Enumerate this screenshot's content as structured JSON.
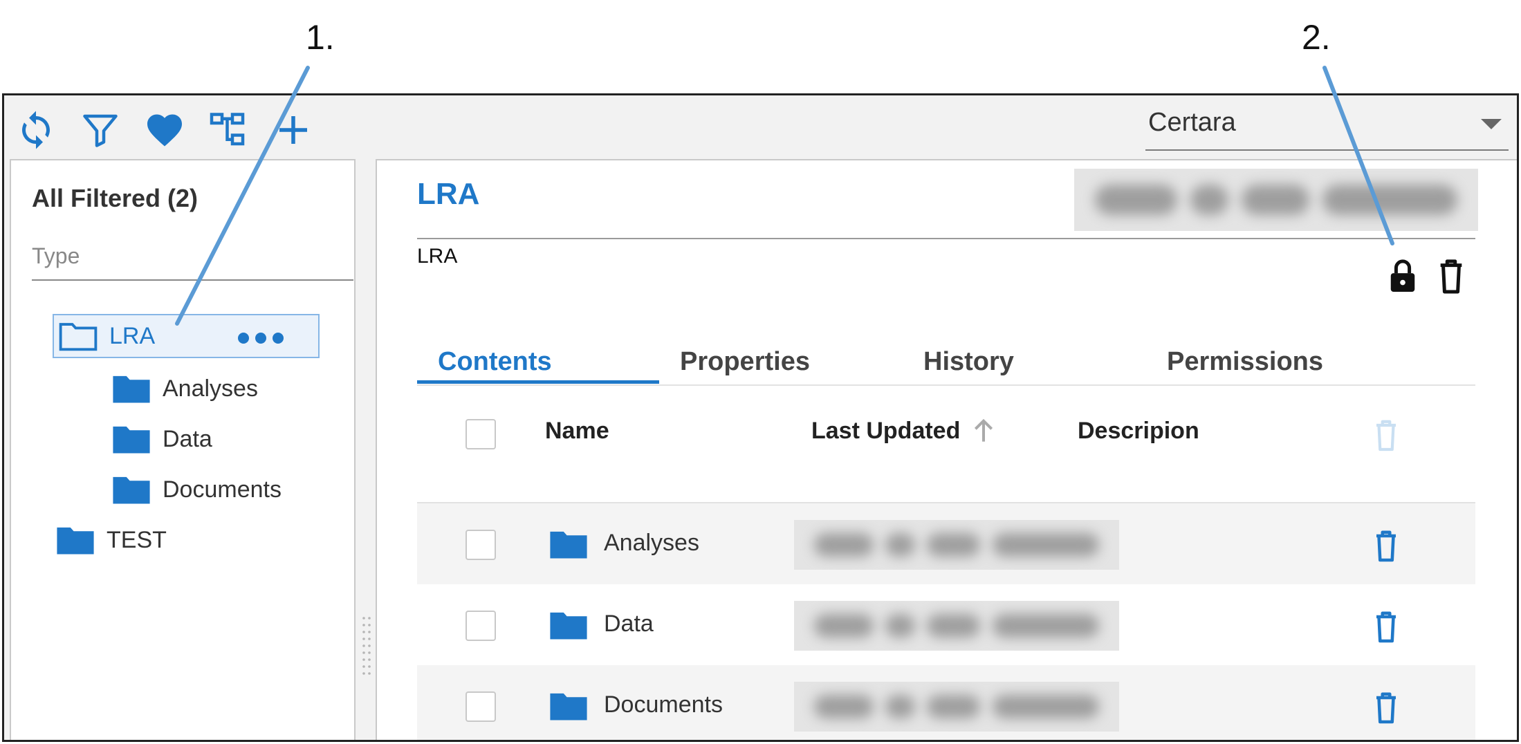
{
  "annotations": {
    "one": "1.",
    "two": "2."
  },
  "toolbar": {
    "icons": [
      "refresh-icon",
      "filter-icon",
      "heart-icon",
      "hierarchy-icon",
      "add-icon"
    ],
    "organization": "Certara"
  },
  "colors": {
    "accent": "#1f78c8",
    "annotation_line": "#5b9bd5"
  },
  "left_panel": {
    "title": "All Filtered (2)",
    "type_label": "Type",
    "tree": [
      {
        "label": "LRA",
        "selected": true
      },
      {
        "label": "Analyses"
      },
      {
        "label": "Data"
      },
      {
        "label": "Documents"
      },
      {
        "label": "TEST"
      }
    ]
  },
  "detail": {
    "title": "LRA",
    "subtitle": "LRA",
    "tabs": [
      {
        "label": "Contents",
        "active": true
      },
      {
        "label": "Properties"
      },
      {
        "label": "History"
      },
      {
        "label": "Permissions"
      }
    ],
    "columns": {
      "name": "Name",
      "last_updated": "Last Updated",
      "description": "Descripion"
    },
    "rows": [
      {
        "name": "Analyses"
      },
      {
        "name": "Data"
      },
      {
        "name": "Documents"
      }
    ]
  }
}
